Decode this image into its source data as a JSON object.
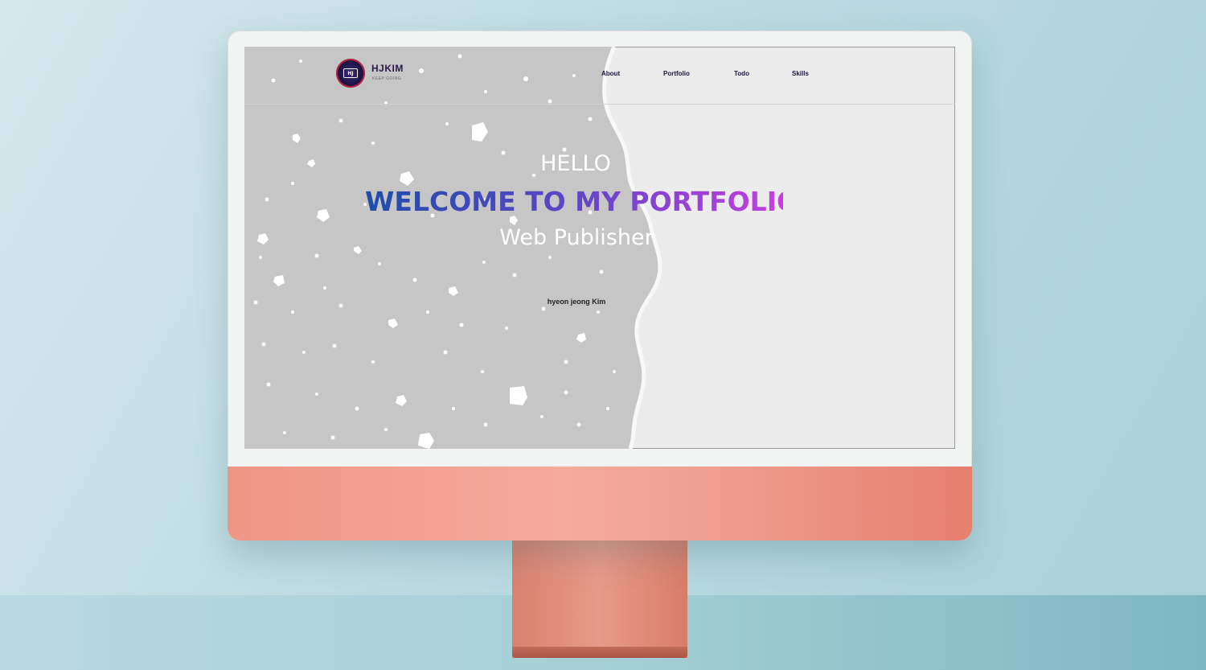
{
  "site": {
    "logo_text": "HJKIM",
    "tagline": "KEEP GOING"
  },
  "nav": {
    "items": [
      {
        "label": "About"
      },
      {
        "label": "Portfolio"
      },
      {
        "label": "Todo"
      },
      {
        "label": "Skills"
      }
    ]
  },
  "hero": {
    "greeting": "HELLO",
    "headline": "WELCOME TO MY PORTFOLIO",
    "role": "Web Publisher",
    "name": "hyeon jeong Kim"
  },
  "colors": {
    "monitor_chin": "#f0a295",
    "headline_gradient_start": "#1d4ea8",
    "headline_gradient_end": "#c640e0",
    "speckled_paper": "#c6c6c6",
    "plain_paper": "#ececec"
  }
}
